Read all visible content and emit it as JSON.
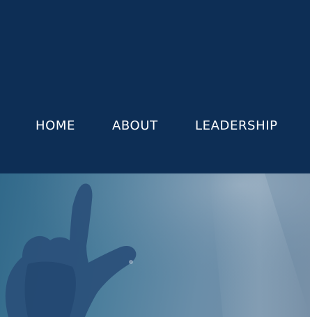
{
  "nav": {
    "items": [
      {
        "label": "HOME"
      },
      {
        "label": "ABOUT"
      },
      {
        "label": "LEADERSHIP"
      }
    ]
  },
  "colors": {
    "header_bg": "#0d2e55",
    "nav_text": "#ffffff",
    "hero_tint": "#4b7e9c",
    "hand_silhouette": "#2a4f79"
  },
  "hero": {
    "image": "hand-pointing-up-photo"
  }
}
